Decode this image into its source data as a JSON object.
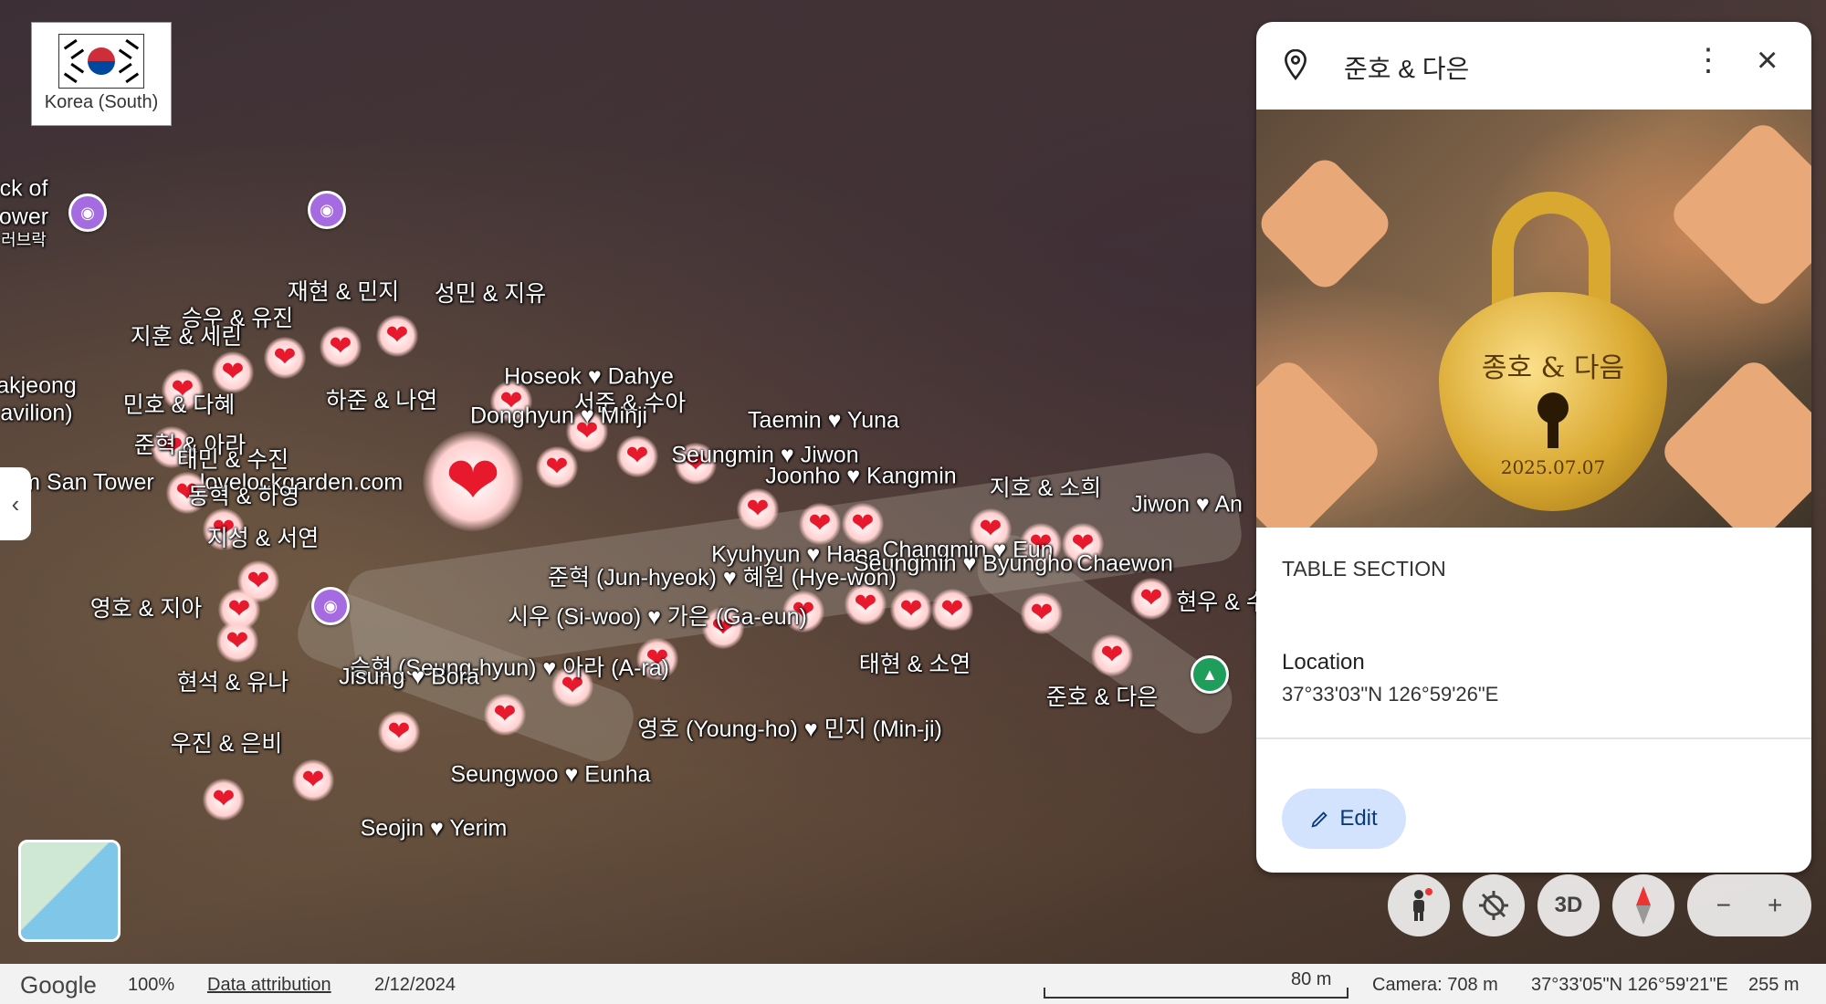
{
  "map": {
    "country_label": "Korea (South)",
    "edge_labels": [
      "ck of",
      "ower",
      "러브락",
      "akjeong",
      "avilion)",
      "m San Tower"
    ],
    "site_label": "lovelockgarden.com",
    "pins": [
      {
        "label": "재현 & 민지"
      },
      {
        "label": "성민 & 지유"
      },
      {
        "label": "승우 & 유진"
      },
      {
        "label": "지훈 & 세린"
      },
      {
        "label": "민호 & 다혜"
      },
      {
        "label": "하준 & 나연"
      },
      {
        "label": "Hoseok ♥ Dahye"
      },
      {
        "label": "서준 & 수아"
      },
      {
        "label": "Donghyun ♥ Minji"
      },
      {
        "label": "Taemin ♥ Yuna"
      },
      {
        "label": "준혁 & 아라"
      },
      {
        "label": "태민 & 수진"
      },
      {
        "label": "Seungmin ♥ Jiwon"
      },
      {
        "label": "Joonho ♥ Kangmin"
      },
      {
        "label": "지호 & 소희"
      },
      {
        "label": "동혁 & 하영"
      },
      {
        "label": "Jiwon ♥ An"
      },
      {
        "label": "지성 & 서연"
      },
      {
        "label": "Kyuhyun ♥ Hana"
      },
      {
        "label": "Changmin ♥ Eun"
      },
      {
        "label": "Seungmin ♥ Byungho"
      },
      {
        "label": "Chaewon"
      },
      {
        "label": "준혁 (Jun-hyeok) ♥ 혜원 (Hye-won)"
      },
      {
        "label": "영호 & 지아"
      },
      {
        "label": "시우 (Si-woo) ♥ 가은 (Ga-eun)"
      },
      {
        "label": "현우 & 수"
      },
      {
        "label": "태현 & 소연"
      },
      {
        "label": "승현 (Seung-hyun) ♥ 아라 (A-ra)"
      },
      {
        "label": "현석 & 유나"
      },
      {
        "label": "Jisung ♥ Bora"
      },
      {
        "label": "준호 & 다은"
      },
      {
        "label": "영호 (Young-ho) ♥ 민지 (Min-ji)"
      },
      {
        "label": "우진 & 은비"
      },
      {
        "label": "Seungwoo ♥ Eunha"
      },
      {
        "label": "Seojin ♥ Yerim"
      }
    ]
  },
  "panel": {
    "title": "준호 & 다은",
    "photo_engraving": "종호 & 다음",
    "photo_date": "2025.07.07",
    "section_heading": "TABLE SECTION",
    "location_label": "Location",
    "location_value": "37°33'03\"N 126°59'26\"E",
    "edit_label": "Edit",
    "icons": {
      "place": "location-pin-icon",
      "more": "more-vert-icon",
      "close": "close-icon",
      "edit": "pencil-icon"
    }
  },
  "controls": {
    "view_3d": "3D",
    "zoom_out": "−",
    "zoom_in": "+"
  },
  "status": {
    "brand": "Google",
    "zoom": "100%",
    "attribution": "Data attribution",
    "date": "2/12/2024",
    "scale": "80 m",
    "camera": "Camera: 708 m",
    "coords": "37°33'05\"N 126°59'21\"E",
    "elevation": "255 m"
  },
  "colors": {
    "heart": "#e8192c",
    "edit_bg": "#d3e3fd",
    "poi": "#a56be0",
    "park": "#1e9e5a"
  }
}
